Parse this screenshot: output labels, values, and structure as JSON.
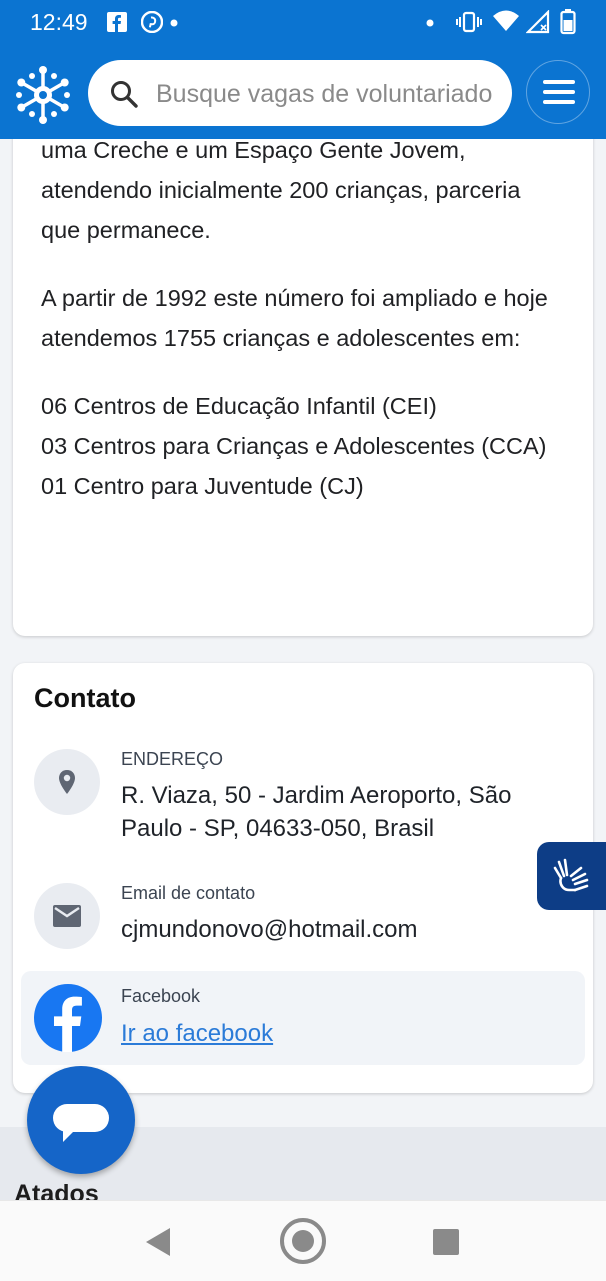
{
  "status_bar": {
    "time": "12:49"
  },
  "header": {
    "search_placeholder": "Busque vagas de voluntariado"
  },
  "about": {
    "paragraphs": [
      "uma Creche e um Espaço Gente Jovem, atendendo inicialmente 200 crianças, parceria que permanece.",
      "A partir de 1992 este número foi ampliado e hoje atendemos 1755 crianças e adolescentes em:"
    ],
    "centers": [
      "06 Centros de Educação Infantil (CEI)",
      "03 Centros para Crianças e Adolescentes (CCA)",
      "01 Centro para Juventude (CJ)"
    ]
  },
  "contact": {
    "title": "Contato",
    "address_label": "ENDEREÇO",
    "address_value": "R. Viaza, 50 - Jardim Aeroporto, São Paulo - SP, 04633-050, Brasil",
    "email_label": "Email de contato",
    "email_value": "cjmundonovo@hotmail.com",
    "facebook_label": "Facebook",
    "facebook_link": "Ir ao facebook"
  },
  "next_section": {
    "heading": "Atados"
  },
  "colors": {
    "brand_blue": "#0b74d1",
    "accessibility_blue": "#0d3d86",
    "link_blue": "#2b7bd8",
    "facebook_blue": "#1877f2"
  },
  "icons": [
    "facebook-icon",
    "pinterest-icon",
    "vibrate-icon",
    "wifi-icon",
    "signal-icon",
    "battery-icon",
    "logo-snowflake-icon",
    "search-icon",
    "menu-icon",
    "location-pin-icon",
    "mail-icon",
    "facebook-logo-icon",
    "sign-language-icon",
    "chat-icon"
  ]
}
